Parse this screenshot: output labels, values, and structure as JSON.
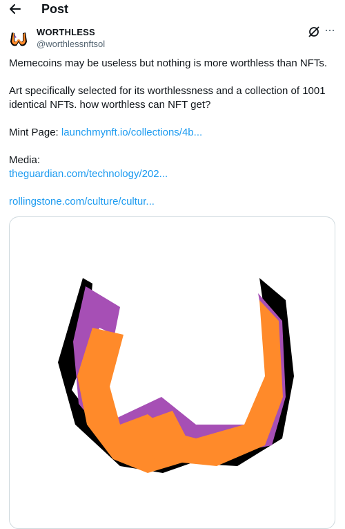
{
  "header": {
    "title": "Post"
  },
  "author": {
    "name": "WORTHLESS",
    "handle": "@worthlessnftsol"
  },
  "tweet": {
    "line1": "Memecoins may be useless but nothing is more worthless than NFTs.",
    "line2": "Art specifically selected for its worthlessness and a collection of 1001 identical NFTs. how worthless can NFT get?",
    "mint_label": "Mint Page: ",
    "mint_link": "launchmynft.io/collections/4b...",
    "media_label": "Media:",
    "media_link1": "theguardian.com/technology/202...",
    "media_link2": "rollingstone.com/culture/cultur..."
  },
  "icons": {
    "back": "arrow-left-icon",
    "grok": "grok-icon",
    "more": "more-icon"
  },
  "colors": {
    "link": "#1d9bf0",
    "secondary_text": "#536471",
    "logo_orange": "#ff8a2a",
    "logo_purple": "#a64fb5",
    "logo_shadow": "#000000"
  }
}
